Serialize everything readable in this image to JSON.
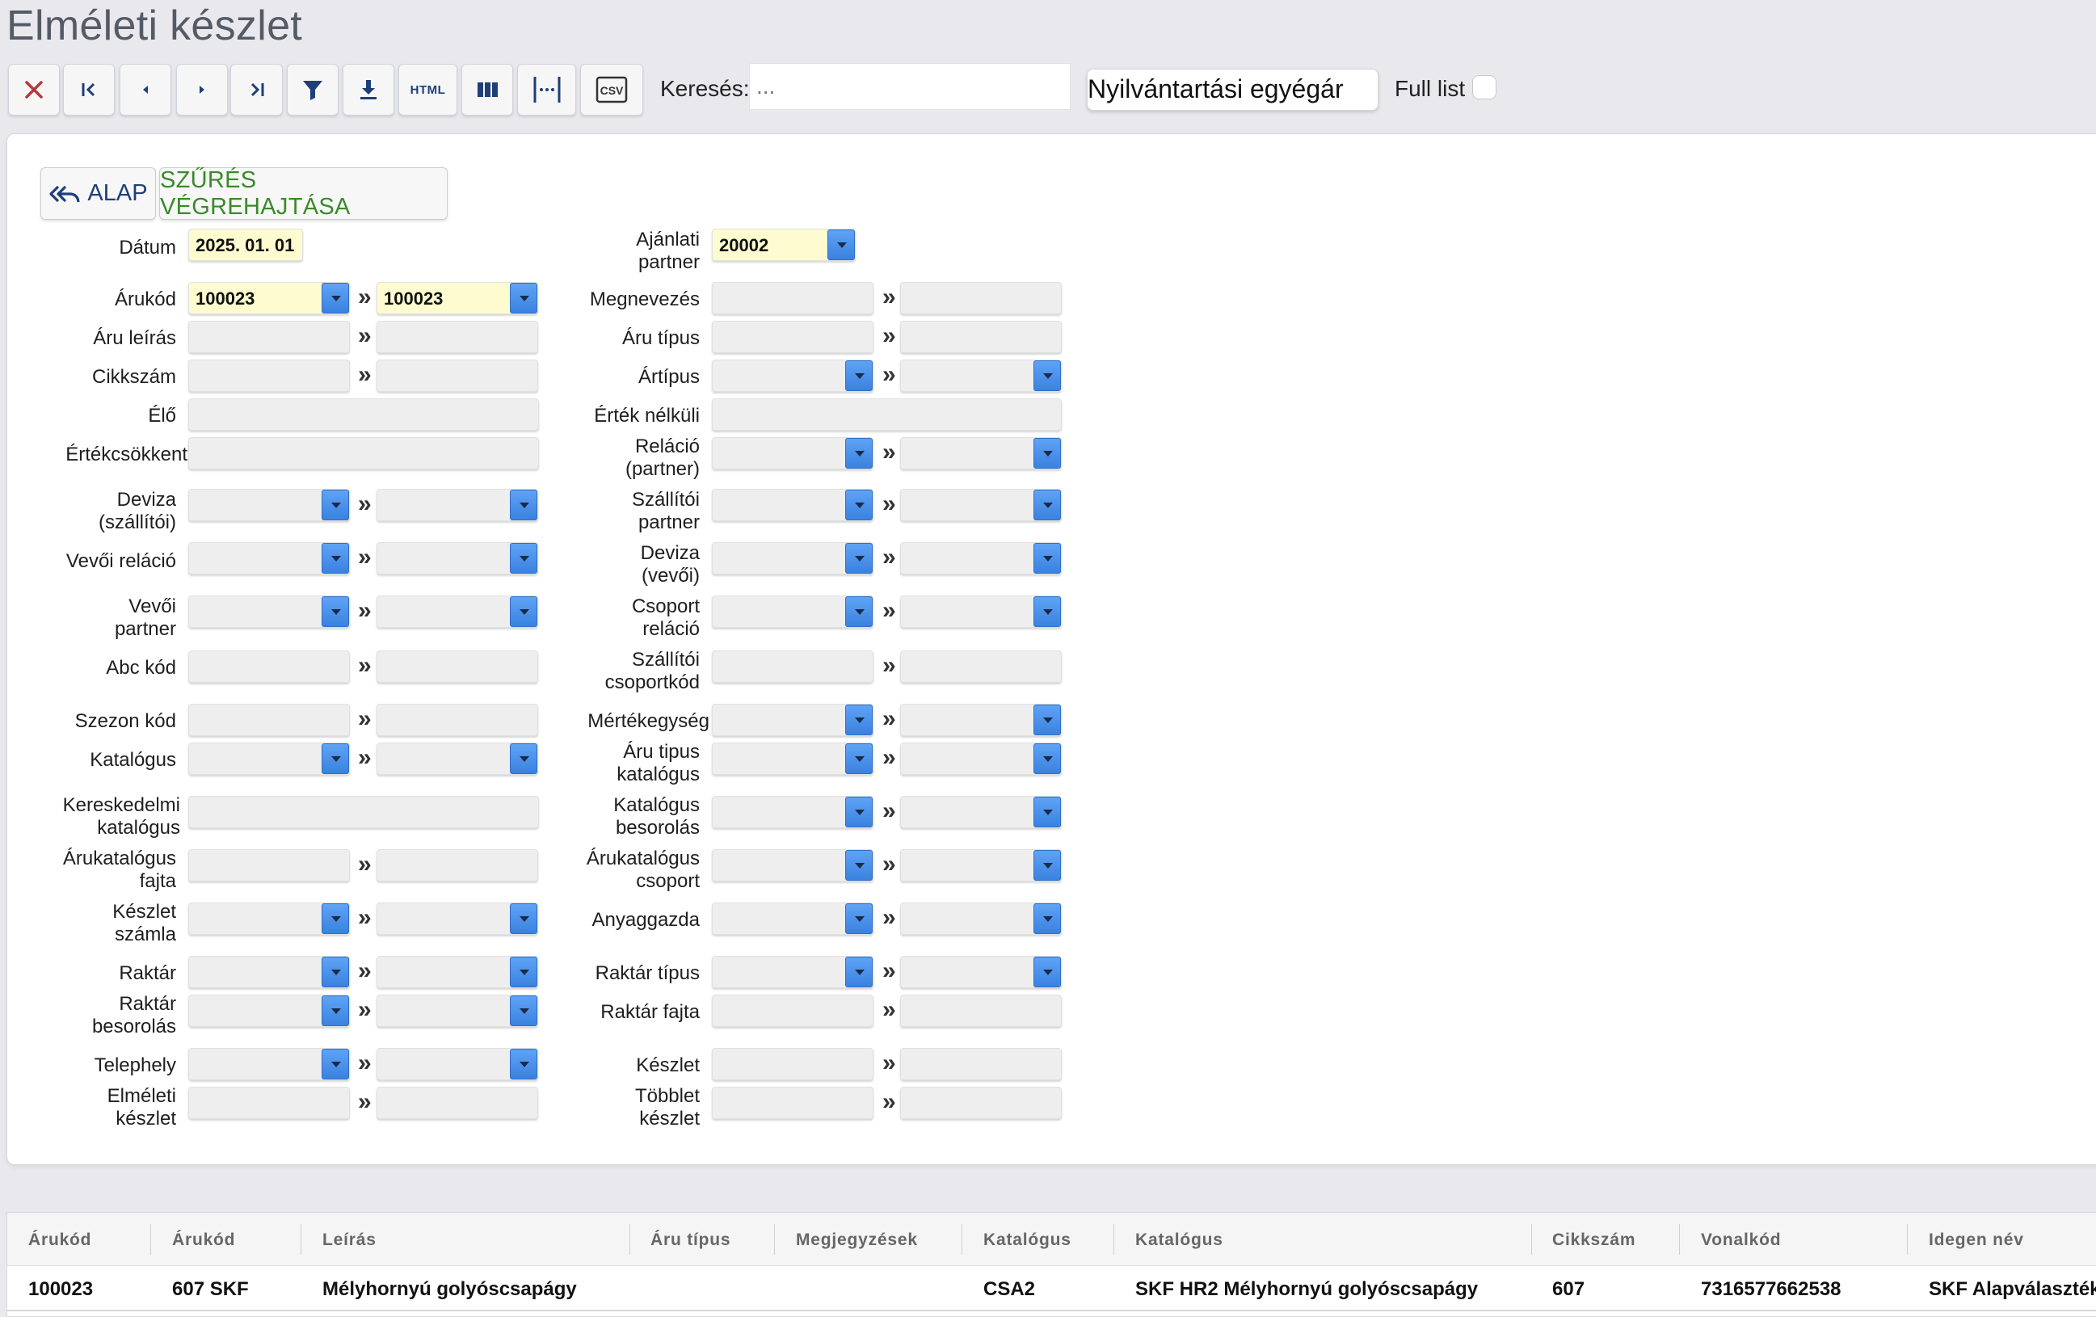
{
  "page_title": "Elméleti készlet",
  "toolbar": {
    "buttons": [
      {
        "name": "close-button",
        "icon": "close-icon"
      },
      {
        "name": "first-button",
        "icon": "first-page-icon"
      },
      {
        "name": "prev-button",
        "icon": "prev-icon"
      },
      {
        "name": "next-button",
        "icon": "next-icon"
      },
      {
        "name": "last-button",
        "icon": "last-page-icon"
      },
      {
        "name": "filter-button",
        "icon": "filter-icon"
      },
      {
        "name": "download-button",
        "icon": "download-icon"
      },
      {
        "name": "html-export-button",
        "icon": "html-icon",
        "label": "HTML"
      },
      {
        "name": "columns-button",
        "icon": "columns-icon"
      },
      {
        "name": "column-width-button",
        "icon": "column-width-icon"
      },
      {
        "name": "csv-export-button",
        "icon": "csv-icon",
        "label": "CSV"
      }
    ],
    "search_label": "Keresés:",
    "search_placeholder": "...",
    "price_select": "Nyilvántartási egyégár",
    "full_list_label": "Full list"
  },
  "filter": {
    "alap_label": "ALAP",
    "szures_label": "SZŰRÉS VÉGREHAJTÁSA",
    "left": {
      "datum": {
        "label": "Dátum",
        "value": "2025. 01. 01"
      },
      "arukod": {
        "label": "Árukód",
        "from": "100023",
        "to": "100023"
      },
      "aru_leiras": "Áru leírás",
      "cikkszam": "Cikkszám",
      "elo": "Élő",
      "ertekcsokkent": "Értékcsökkent",
      "deviza_szallitoi": [
        "Deviza",
        "(szállítói)"
      ],
      "vevoi_relacio": "Vevői reláció",
      "vevoi_partner": [
        "Vevői",
        "partner"
      ],
      "abc_kod": "Abc kód",
      "szezon_kod": "Szezon kód",
      "katalogus": "Katalógus",
      "kereskedelmi_katalogus": [
        "Kereskedelmi",
        "katalógus"
      ],
      "arukatalogus_fajta": [
        "Árukatalógus",
        "fajta"
      ],
      "keszlet_szamla": [
        "Készlet",
        "számla"
      ],
      "raktar": "Raktár",
      "raktar_besorolas": [
        "Raktár",
        "besorolás"
      ],
      "telephely": "Telephely",
      "elmeleti_keszlet": [
        "Elméleti",
        "készlet"
      ]
    },
    "right": {
      "ajanlati_partner": {
        "label": [
          "Ajánlati",
          "partner"
        ],
        "value": "20002"
      },
      "megnevezes": "Megnevezés",
      "aru_tipus": "Áru típus",
      "artipus": "Ártípus",
      "ertek_nelkuli": "Érték nélküli",
      "relacio_partner": [
        "Reláció",
        "(partner)"
      ],
      "szallitoi_partner": [
        "Szállítói",
        "partner"
      ],
      "deviza_vevoi": [
        "Deviza",
        "(vevői)"
      ],
      "csoport_relacio": [
        "Csoport",
        "reláció"
      ],
      "szallitoi_csoportkod": [
        "Szállítói",
        "csoportkód"
      ],
      "mertekegyseg": "Mértékegység",
      "aru_tipus_katalogus": [
        "Áru tipus",
        "katalógus"
      ],
      "katalogus_besorolas": [
        "Katalógus",
        "besorolás"
      ],
      "arukatalogus_csoport": [
        "Árukatalógus",
        "csoport"
      ],
      "anyaggazda": "Anyaggazda",
      "raktar_tipus": "Raktár típus",
      "raktar_fajta": "Raktár fajta",
      "keszlet": "Készlet",
      "tobblet_keszlet": [
        "Többlet",
        "készlet"
      ]
    },
    "range_separator": "»"
  },
  "table": {
    "headers": [
      "Árukód",
      "Árukód",
      "Leírás",
      "Áru típus",
      "Megjegyzések",
      "Katalógus",
      "Katalógus",
      "Cikkszám",
      "Vonalkód",
      "Idegen név"
    ],
    "rows": [
      [
        "100023",
        "607 SKF",
        "Mélyhornyú golyóscsapágy",
        "",
        "",
        "CSA2",
        "SKF HR2 Mélyhornyú golyóscsapágy",
        "607",
        "7316577662538",
        "SKF Alapválaszték"
      ]
    ]
  },
  "colors": {
    "accent_blue": "#3b82e0",
    "filled_field": "#fdfbcf",
    "szures_green": "#3a8a2a",
    "close_red": "#c0392b"
  }
}
